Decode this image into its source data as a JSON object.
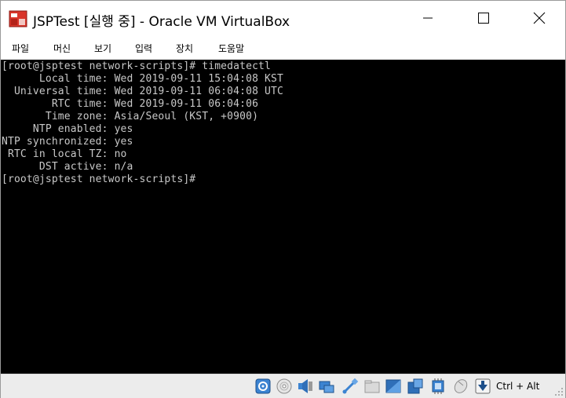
{
  "window": {
    "title": "JSPTest [실행 중] - Oracle VM VirtualBox"
  },
  "menu": {
    "items": [
      "파일",
      "머신",
      "보기",
      "입력",
      "장치",
      "도움말"
    ]
  },
  "terminal": {
    "lines": [
      "[root@jsptest network-scripts]# timedatectl",
      "      Local time: Wed 2019-09-11 15:04:08 KST",
      "  Universal time: Wed 2019-09-11 06:04:08 UTC",
      "        RTC time: Wed 2019-09-11 06:04:06",
      "       Time zone: Asia/Seoul (KST, +0900)",
      "     NTP enabled: yes",
      "NTP synchronized: yes",
      " RTC in local TZ: no",
      "      DST active: n/a",
      "[root@jsptest network-scripts]#"
    ]
  },
  "statusbar": {
    "icons": [
      "hard-disk-icon",
      "optical-drive-icon",
      "audio-icon",
      "network-icon",
      "usb-icon",
      "shared-folders-icon",
      "display-icon",
      "video-capture-icon",
      "cpu-icon",
      "mouse-integration-icon",
      "keyboard-capture-icon"
    ],
    "host_key": "Ctrl + Alt"
  },
  "colors": {
    "terminal_bg": "#000000",
    "terminal_fg": "#c8c8c8",
    "statusbar_bg": "#ececec"
  }
}
